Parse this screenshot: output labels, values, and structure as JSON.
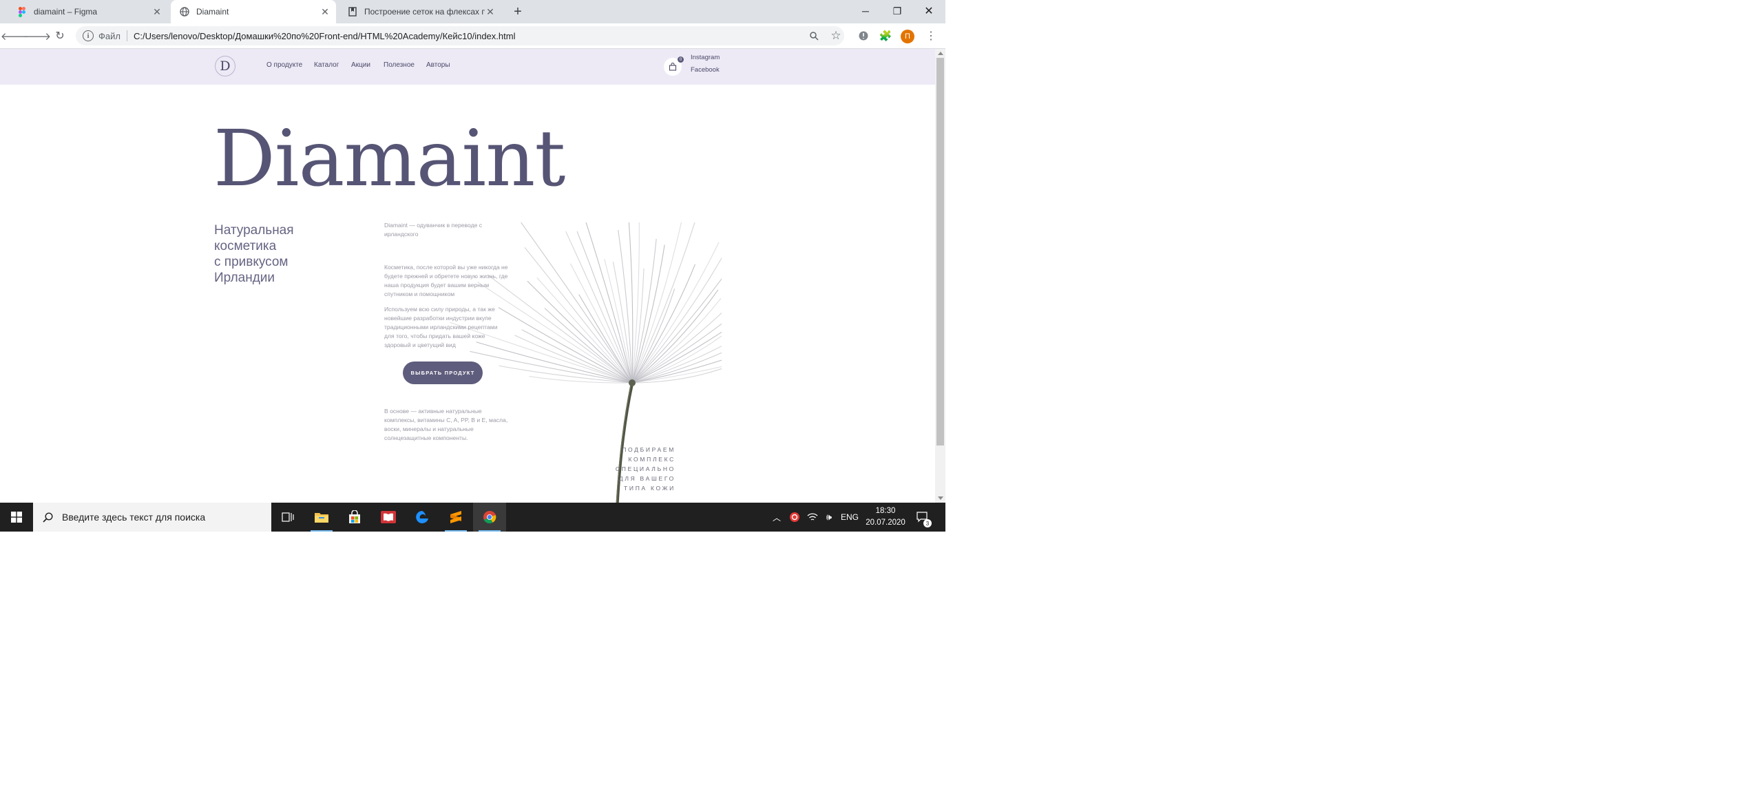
{
  "browser": {
    "tabs": [
      {
        "title": "diamaint – Figma",
        "icon": "figma-icon",
        "active": false
      },
      {
        "title": "Diamaint",
        "icon": "globe-icon",
        "active": true
      },
      {
        "title": "Построение сеток на флексах п",
        "icon": "bookmark-page-icon",
        "active": false
      }
    ],
    "new_tab_icon": "plus-icon",
    "window_controls": [
      "minimize-icon",
      "restore-icon",
      "close-icon"
    ],
    "toolbar": {
      "back_icon": "back-arrow-icon",
      "forward_icon": "forward-arrow-icon",
      "reload_icon": "reload-icon",
      "scheme_label": "Файл",
      "url": "C:/Users/lenovo/Desktop/Домашки%20по%20Front-end/HTML%20Academy/Кейс10/index.html",
      "profile_initial": "П"
    }
  },
  "site": {
    "logo": "D",
    "nav": [
      "О продукте",
      "Каталог",
      "Акции",
      "Полезное",
      "Авторы"
    ],
    "cart_count": "0",
    "social": [
      "Instagram",
      "Facebook"
    ],
    "hero_title": "Diamaint",
    "tagline": [
      "Натуральная",
      "косметика",
      "с привкусом",
      "Ирландии"
    ],
    "intro": [
      "Diamaint — одуванчик в переводе с",
      "ирландского"
    ],
    "paragraph1": [
      "Косметика, после которой вы уже никогда не",
      "будете прежней и обретете новую жизнь, где",
      "наша продукция будет вашим верным",
      "спутником и помощником"
    ],
    "paragraph2": [
      "Используем всю силу природы, а так же",
      "новейшие разработки индустрии вкупе",
      "традиционными ирландскими рецептами",
      "для того, чтобы придать вашей коже",
      "здоровый и цветущий вид"
    ],
    "cta": "ВЫБРАТЬ ПРОДУКТ",
    "ingredients": [
      "В основе — активные натуральные",
      "комплексы, витамины C, A, PP, B и E, масла,",
      "воски, минералы и натуральные",
      "солнцезащитные компоненты."
    ],
    "side_caption": [
      "ПОДБИРАЕМ",
      "КОМПЛЕКС",
      "СПЕЦИАЛЬНО",
      "ДЛЯ ВАШЕГО",
      "ТИПА КОЖИ"
    ],
    "colors": {
      "accent": "#5f5d7d",
      "header_bg": "#edeaf6",
      "title": "#575575"
    }
  },
  "taskbar": {
    "search_placeholder": "Введите здесь текст для поиска",
    "apps": [
      "task-view-icon",
      "file-explorer-icon",
      "store-icon",
      "reader-icon",
      "edge-icon",
      "sublime-icon",
      "chrome-icon"
    ],
    "language": "ENG",
    "time": "18:30",
    "date": "20.07.2020",
    "notifications": "3"
  }
}
